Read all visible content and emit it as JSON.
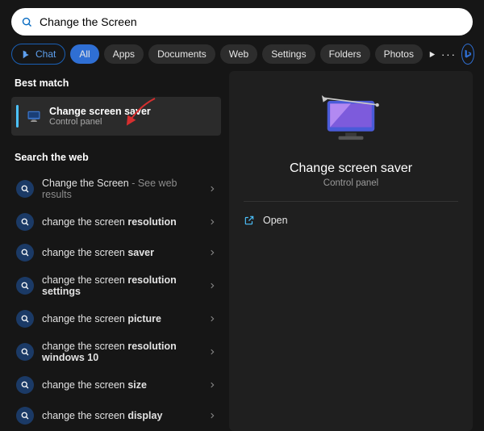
{
  "search": {
    "value": "Change the Screen"
  },
  "filters": {
    "chat": "Chat",
    "all": "All",
    "apps": "Apps",
    "documents": "Documents",
    "web": "Web",
    "settings": "Settings",
    "folders": "Folders",
    "photos": "Photos"
  },
  "sections": {
    "best_match": "Best match",
    "search_web": "Search the web"
  },
  "best": {
    "title": "Change screen saver",
    "subtitle": "Control panel"
  },
  "web": [
    {
      "prefix": "Change the Screen",
      "bold": "",
      "suffix": " - See web results"
    },
    {
      "prefix": "change the screen ",
      "bold": "resolution",
      "suffix": ""
    },
    {
      "prefix": "change the screen ",
      "bold": "saver",
      "suffix": ""
    },
    {
      "prefix": "change the screen ",
      "bold": "resolution settings",
      "suffix": ""
    },
    {
      "prefix": "change the screen ",
      "bold": "picture",
      "suffix": ""
    },
    {
      "prefix": "change the screen ",
      "bold": "resolution windows 10",
      "suffix": ""
    },
    {
      "prefix": "change the screen ",
      "bold": "size",
      "suffix": ""
    },
    {
      "prefix": "change the screen ",
      "bold": "display",
      "suffix": ""
    }
  ],
  "detail": {
    "title": "Change screen saver",
    "subtitle": "Control panel",
    "open": "Open"
  }
}
